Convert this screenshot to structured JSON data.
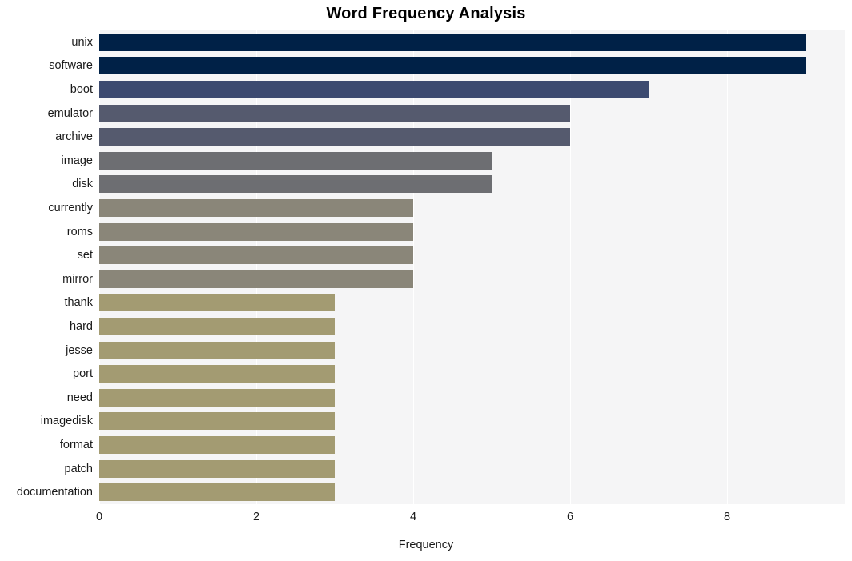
{
  "chart_data": {
    "type": "bar",
    "orientation": "horizontal",
    "title": "Word Frequency Analysis",
    "xlabel": "Frequency",
    "ylabel": "",
    "xlim": [
      0,
      9.5
    ],
    "xticks": [
      0,
      2,
      4,
      6,
      8
    ],
    "xtick_labels": [
      "0",
      "2",
      "4",
      "6",
      "8"
    ],
    "grid": true,
    "legend": "none",
    "categories": [
      "unix",
      "software",
      "boot",
      "emulator",
      "archive",
      "image",
      "disk",
      "currently",
      "roms",
      "set",
      "mirror",
      "thank",
      "hard",
      "jesse",
      "port",
      "need",
      "imagedisk",
      "format",
      "patch",
      "documentation"
    ],
    "values": [
      9,
      9,
      7,
      6,
      6,
      5,
      5,
      4,
      4,
      4,
      4,
      3,
      3,
      3,
      3,
      3,
      3,
      3,
      3,
      3
    ],
    "bar_colors": [
      "#002147",
      "#002147",
      "#3c4a70",
      "#555a6e",
      "#555a6e",
      "#6d6e72",
      "#6d6e72",
      "#8a8679",
      "#8a8679",
      "#8a8679",
      "#8a8679",
      "#a39b72",
      "#a39b72",
      "#a39b72",
      "#a39b72",
      "#a39b72",
      "#a39b72",
      "#a39b72",
      "#a39b72",
      "#a39b72"
    ],
    "plot_background": "#f5f5f6",
    "gridline_color": "#ffffff",
    "figure_background": "#ffffff",
    "text_color": "#1a1a1a"
  }
}
